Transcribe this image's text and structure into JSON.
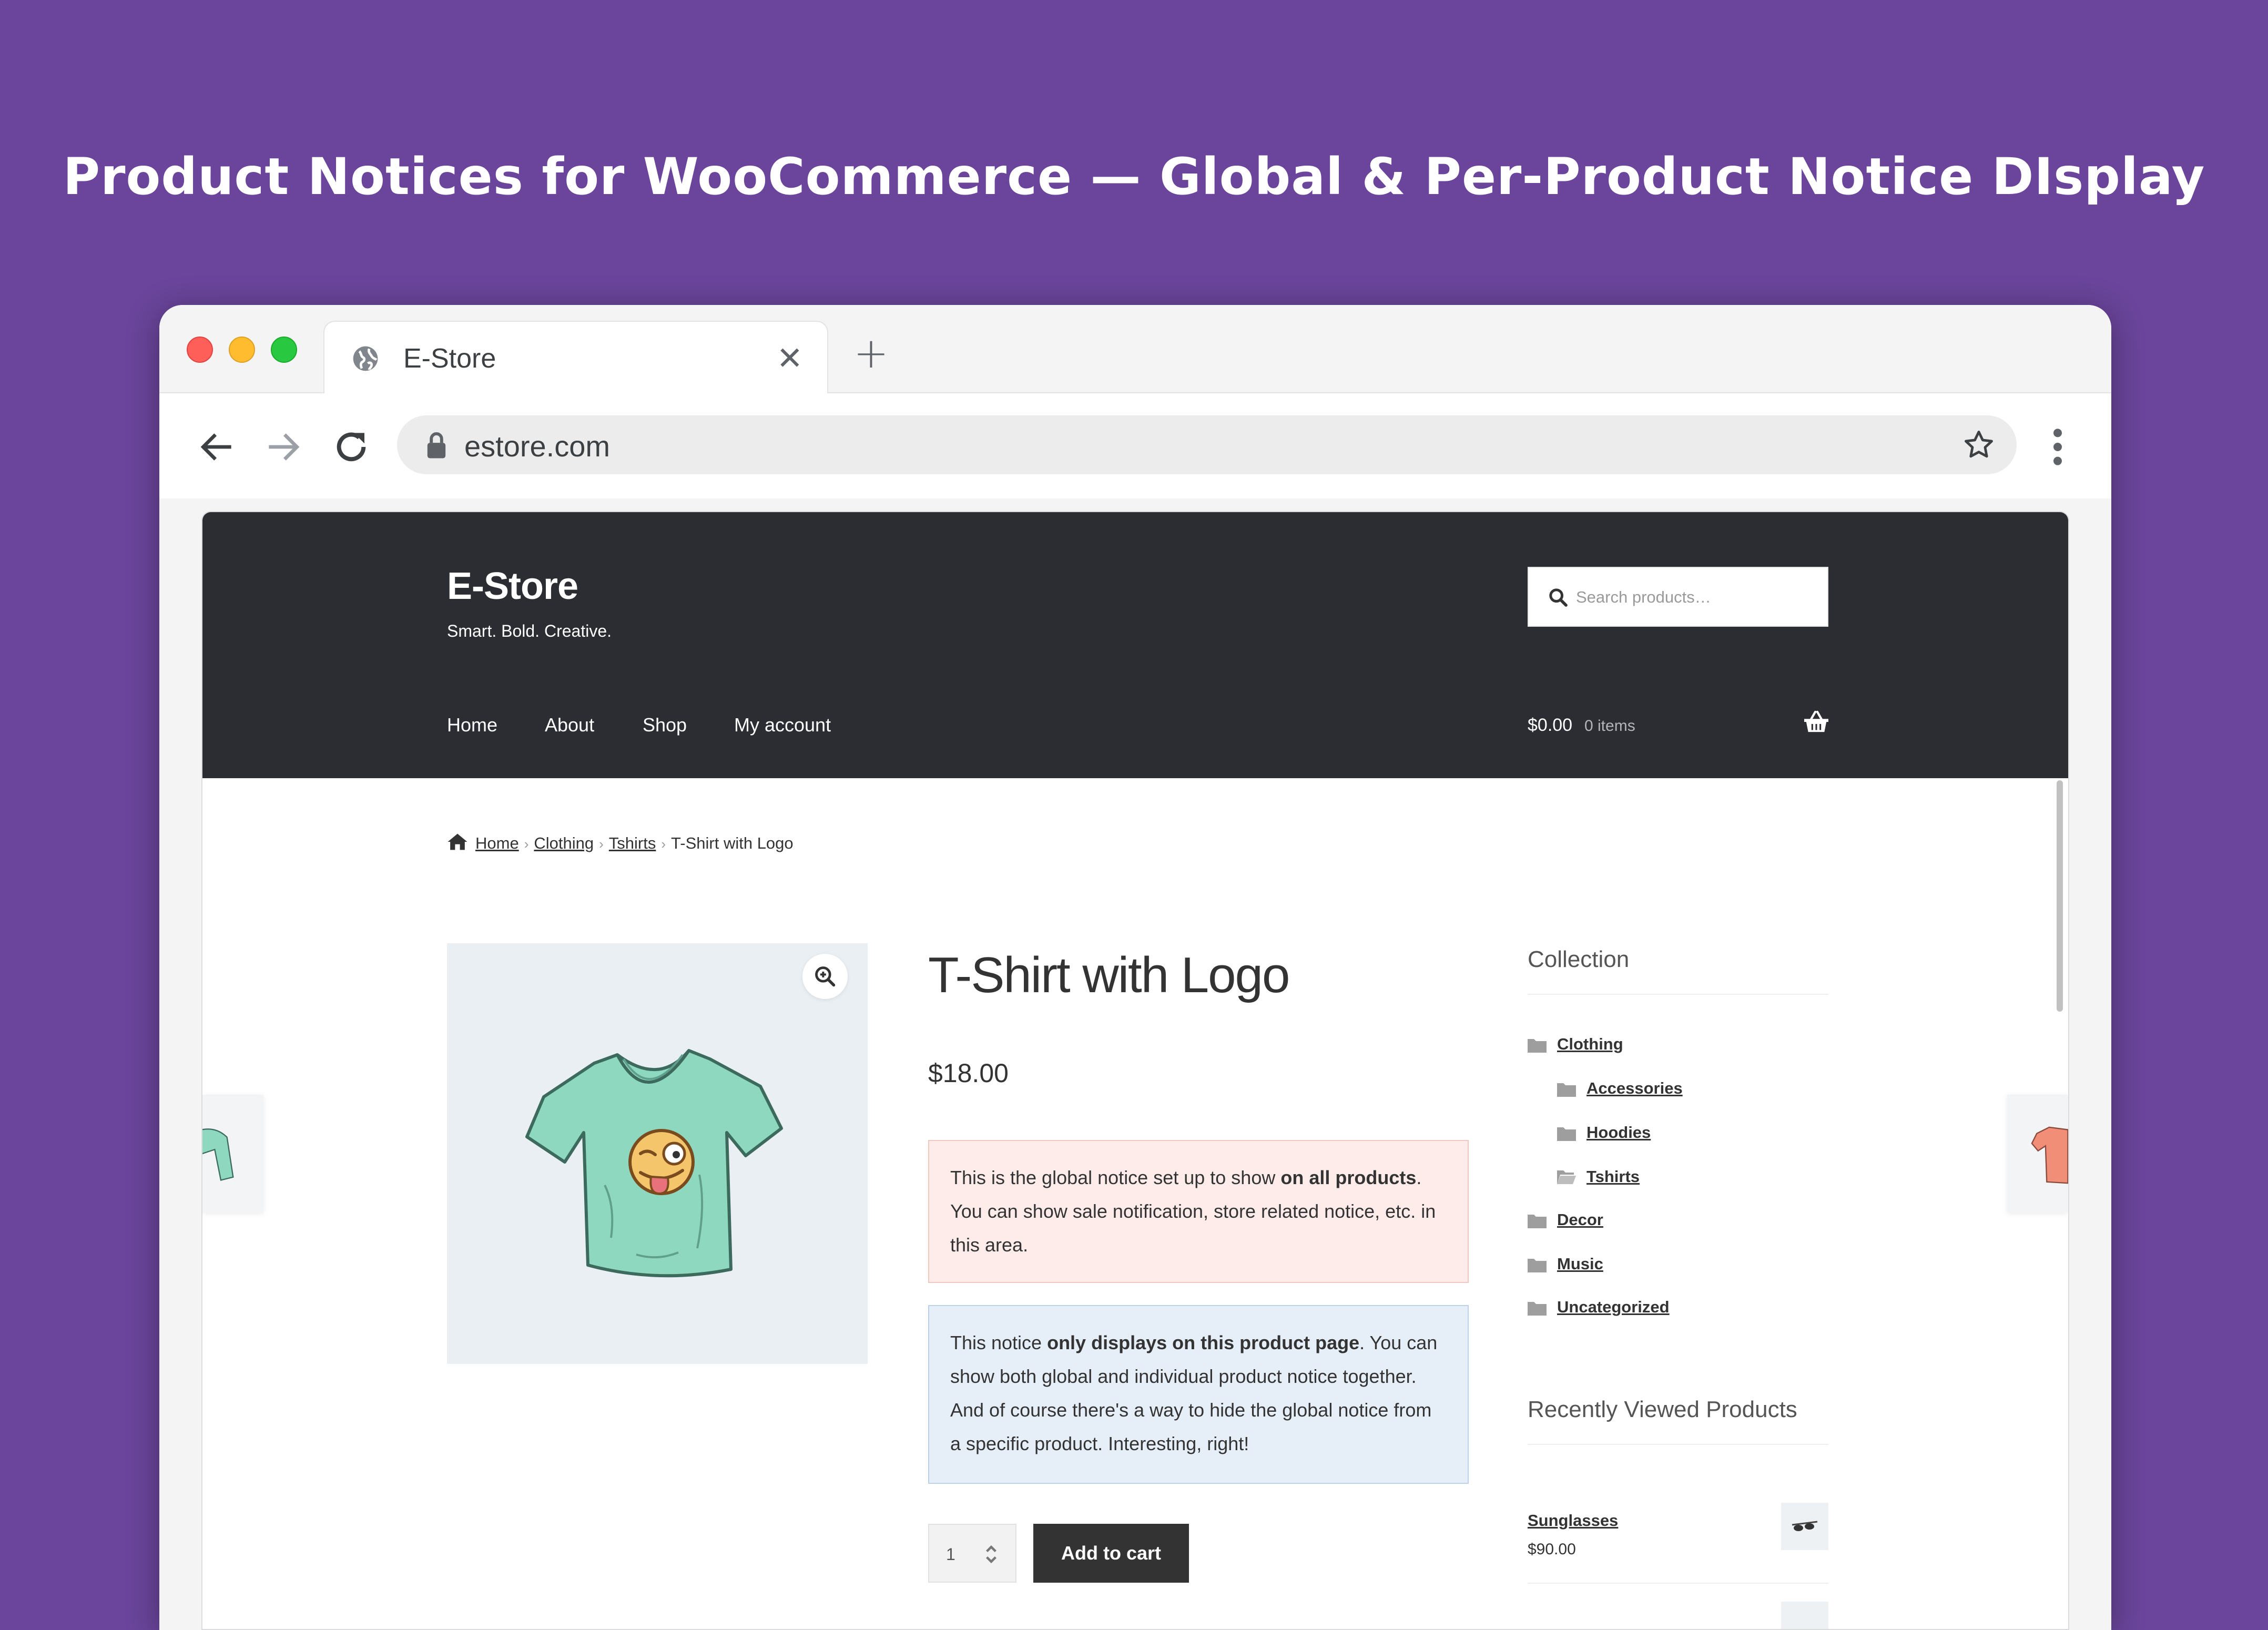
{
  "hero": {
    "title": "Product Notices for WooCommerce — Global & Per-Product Notice DIsplay"
  },
  "browser": {
    "tab_title": "E-Store",
    "tab_close": "✕",
    "new_tab": "+",
    "url": "estore.com"
  },
  "store": {
    "name": "E-Store",
    "tagline": "Smart. Bold. Creative.",
    "search_placeholder": "Search products…",
    "nav": [
      "Home",
      "About",
      "Shop",
      "My account"
    ],
    "cart_amount": "$0.00",
    "cart_count": "0 items"
  },
  "breadcrumb": {
    "items": [
      "Home",
      "Clothing",
      "Tshirts"
    ],
    "current": "T-Shirt with Logo",
    "separator": "›"
  },
  "product": {
    "title": "T-Shirt with Logo",
    "price": "$18.00",
    "quantity": "1",
    "add_to_cart": "Add to cart"
  },
  "notices": {
    "global": {
      "pre": "This is the global notice set up to show ",
      "bold": "on all products",
      "post": ". You can show sale notification, store related notice, etc. in this area."
    },
    "product": {
      "pre": "This notice ",
      "bold": "only displays on this product page",
      "post": ". You can show both global and individual product notice together. And of course there's a way to hide the global notice from a specific product. Interesting, right!"
    }
  },
  "sidebar": {
    "collection_title": "Collection",
    "categories": [
      "Clothing",
      "Accessories",
      "Hoodies",
      "Tshirts",
      "Decor",
      "Music",
      "Uncategorized"
    ],
    "recent_title": "Recently Viewed Products",
    "recent": [
      {
        "name": "Sunglasses",
        "price": "$90.00"
      }
    ]
  },
  "colors": {
    "background": "#6a459b",
    "header": "#2c2d33",
    "global_notice": "#fdecea",
    "product_notice": "#e6eef8",
    "tshirt": "#8ed8bf"
  }
}
